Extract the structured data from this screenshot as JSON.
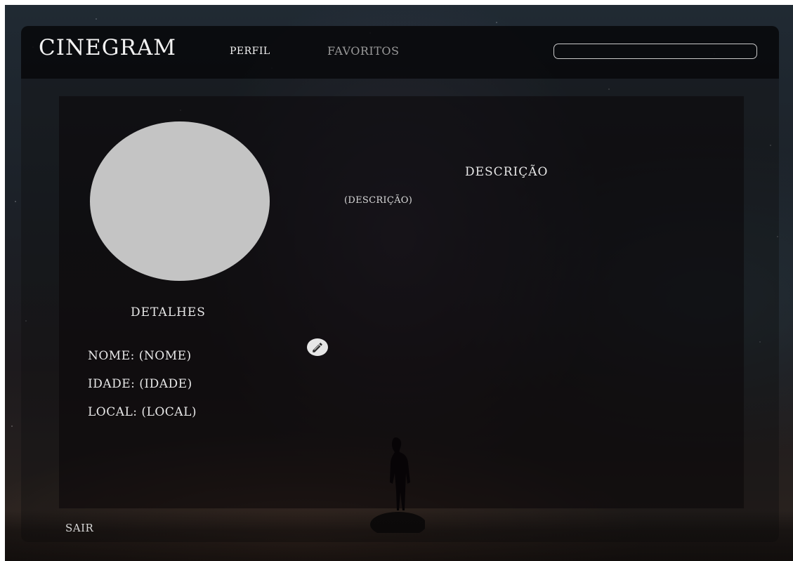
{
  "header": {
    "logo": "CINEGRAM",
    "nav": {
      "profile_label": "PERFIL",
      "favorites_label": "FAVORITOS"
    },
    "search": {
      "value": "",
      "placeholder": ""
    }
  },
  "profile": {
    "details_heading": "DETALHES",
    "name_row": "NOME: (NOME)",
    "age_row": "IDADE: (IDADE)",
    "location_row": "LOCAL: (LOCAL)",
    "description_heading": "DESCRIÇÃO",
    "description_text": "(DESCRIÇÃO)",
    "edit_icon": "pencil-icon"
  },
  "footer": {
    "logout_label": "SAIR"
  },
  "colors": {
    "navbar_bg": "#08080a",
    "avatar_placeholder": "#c4c4c4",
    "active_nav": "#f3f3f3",
    "inactive_nav": "#9a9a9a"
  }
}
